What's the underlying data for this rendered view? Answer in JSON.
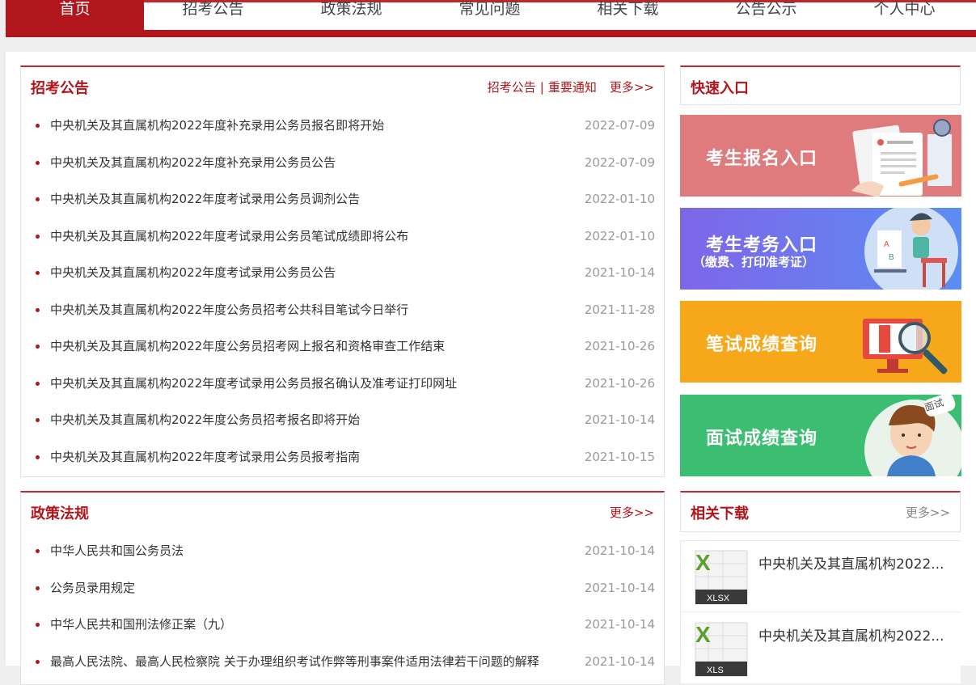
{
  "nav": [
    "首页",
    "招考公告",
    "政策法规",
    "常见问题",
    "相关下载",
    "公告公示",
    "个人中心"
  ],
  "announcements": {
    "title": "招考公告",
    "links": [
      "招考公告",
      "重要通知"
    ],
    "separator": "|",
    "more": "更多>>",
    "items": [
      {
        "title": "中央机关及其直属机构2022年度补充录用公务员报名即将开始",
        "date": "2022-07-09"
      },
      {
        "title": "中央机关及其直属机构2022年度补充录用公务员公告",
        "date": "2022-07-09"
      },
      {
        "title": "中央机关及其直属机构2022年度考试录用公务员调剂公告",
        "date": "2022-01-10"
      },
      {
        "title": "中央机关及其直属机构2022年度考试录用公务员笔试成绩即将公布",
        "date": "2022-01-10"
      },
      {
        "title": "中央机关及其直属机构2022年度考试录用公务员公告",
        "date": "2021-10-14"
      },
      {
        "title": "中央机关及其直属机构2022年度公务员招考公共科目笔试今日举行",
        "date": "2021-11-28"
      },
      {
        "title": "中央机关及其直属机构2022年度公务员招考网上报名和资格审查工作结束",
        "date": "2021-10-26"
      },
      {
        "title": "中央机关及其直属机构2022年度考试录用公务员报名确认及准考证打印网址",
        "date": "2021-10-26"
      },
      {
        "title": "中央机关及其直属机构2022年度公务员招考报名即将开始",
        "date": "2021-10-14"
      },
      {
        "title": "中央机关及其直属机构2022年度考试录用公务员报考指南",
        "date": "2021-10-15"
      }
    ]
  },
  "policies": {
    "title": "政策法规",
    "more": "更多>>",
    "items": [
      {
        "title": "中华人民共和国公务员法",
        "date": "2021-10-14"
      },
      {
        "title": "公务员录用规定",
        "date": "2021-10-14"
      },
      {
        "title": "中华人民共和国刑法修正案（九）",
        "date": "2021-10-14"
      },
      {
        "title": "最高人民法院、最高人民检察院 关于办理组织考试作弊等刑事案件适用法律若干问题的解释",
        "date": "2021-10-14"
      }
    ]
  },
  "quick_entry": {
    "title": "快速入口",
    "cards": [
      {
        "label": "考生报名入口",
        "sub": "",
        "color": "#e07b7d"
      },
      {
        "label": "考生考务入口",
        "sub": "（缴费、打印准考证）",
        "color": "#6f79ee"
      },
      {
        "label": "笔试成绩查询",
        "sub": "",
        "color": "#f7a81a"
      },
      {
        "label": "面试成绩查询",
        "sub": "",
        "color": "#3cbe72",
        "tag": "面试"
      }
    ]
  },
  "downloads": {
    "title": "相关下载",
    "more": "更多>>",
    "file_tag": "XLSX",
    "file_tag_cut": "XLS",
    "items": [
      {
        "name": "中央机关及其直属机构2022..."
      },
      {
        "name": "中央机关及其直属机构2022..."
      }
    ]
  },
  "colors": {
    "brand_red": "#b0161c"
  }
}
